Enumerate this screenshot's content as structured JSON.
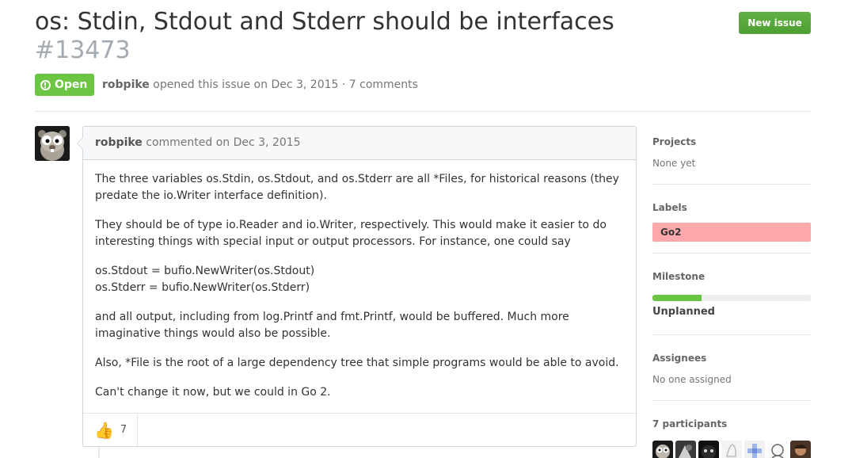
{
  "issue": {
    "title": "os: Stdin, Stdout and Stderr should be interfaces",
    "number": "#13473",
    "state": "Open",
    "author": "robpike",
    "opened_text": "opened this issue on Dec 3, 2015 · 7 comments"
  },
  "header": {
    "new_issue_label": "New issue"
  },
  "comment": {
    "author": "robpike",
    "meta": "commented on Dec 3, 2015",
    "paragraphs": [
      "The three variables os.Stdin, os.Stdout, and os.Stderr are all *Files, for historical reasons (they predate the io.Writer interface definition).",
      "They should be of type io.Reader and io.Writer, respectively. This would make it easier to do interesting things with special input or output processors. For instance, one could say",
      "and all output, including from log.Printf and fmt.Printf, would be buffered. Much more imaginative things would also be possible.",
      "Also, *File is the root of a large dependency tree that simple programs would be able to avoid.",
      "Can't change it now, but we could in Go 2."
    ],
    "code_lines": [
      "os.Stdout = bufio.NewWriter(os.Stdout)",
      "os.Stderr = bufio.NewWriter(os.Stderr)"
    ],
    "reaction": {
      "icon": "thumbs-up-icon",
      "count": "7"
    }
  },
  "sidebar": {
    "projects": {
      "heading": "Projects",
      "value": "None yet"
    },
    "labels": {
      "heading": "Labels",
      "items": [
        {
          "name": "Go2",
          "color": "#fda9ab"
        }
      ]
    },
    "milestone": {
      "heading": "Milestone",
      "name": "Unplanned",
      "progress": 0.31
    },
    "assignees": {
      "heading": "Assignees",
      "value": "No one assigned"
    },
    "participants": {
      "heading": "7 participants"
    }
  },
  "colors": {
    "open_green": "#6cc644",
    "button_green": "#5ca941",
    "label_go2": "#fda9ab"
  }
}
